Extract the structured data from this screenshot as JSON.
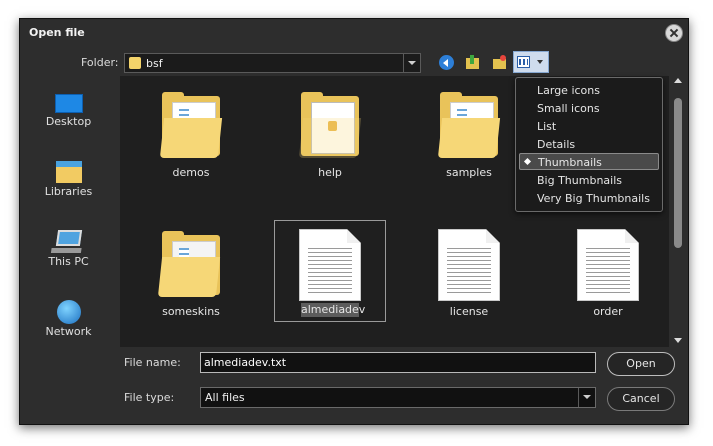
{
  "window": {
    "title": "Open file"
  },
  "toolbar": {
    "folder_label": "Folder:",
    "folder_value": "bsf"
  },
  "places": [
    {
      "label": "Desktop",
      "icon": "desktop-icon"
    },
    {
      "label": "Libraries",
      "icon": "libraries-icon"
    },
    {
      "label": "This PC",
      "icon": "this-pc-icon"
    },
    {
      "label": "Network",
      "icon": "network-icon"
    }
  ],
  "files": [
    {
      "name": "demos",
      "type": "folder"
    },
    {
      "name": "help",
      "type": "folder"
    },
    {
      "name": "samples",
      "type": "folder"
    },
    {
      "name": "someskins",
      "type": "folder"
    },
    {
      "name": "almediadev",
      "type": "text-file",
      "selected": true
    },
    {
      "name": "license",
      "type": "text-file"
    },
    {
      "name": "order",
      "type": "text-file"
    }
  ],
  "view_menu": {
    "items": [
      "Large icons",
      "Small icons",
      "List",
      "Details",
      "Thumbnails",
      "Big Thumbnails",
      "Very Big Thumbnails"
    ],
    "selected": "Thumbnails"
  },
  "file_name": {
    "label": "File name:",
    "value": "almediadev.txt"
  },
  "file_type": {
    "label": "File type:",
    "value": "All files"
  },
  "buttons": {
    "open": "Open",
    "cancel": "Cancel"
  }
}
